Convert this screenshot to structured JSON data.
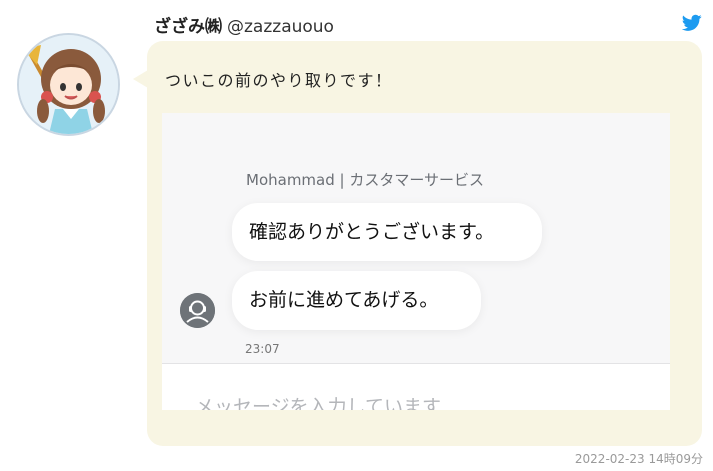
{
  "user": {
    "display_name": "ざざみ㈱",
    "handle": "@zazzauouo"
  },
  "tweet": {
    "text": "ついこの前のやり取りです！",
    "date": "2022-02-23 14時09分"
  },
  "chat_screenshot": {
    "agent_label": "Mohammad | カスタマーサービス",
    "messages": [
      "確認ありがとうございます。",
      "お前に進めてあげる。"
    ],
    "time": "23:07",
    "input_placeholder": "メッセージを入力しています..."
  },
  "colors": {
    "bubble": "#f8f5e3",
    "twitter_blue": "#1d9bf0"
  },
  "icons": {
    "twitter": "twitter-bird-icon",
    "agent": "agent-avatar-icon"
  }
}
